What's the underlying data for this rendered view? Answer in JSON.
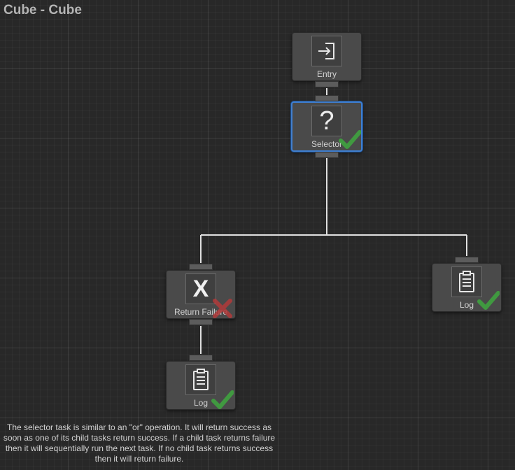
{
  "window": {
    "title": "Cube - Cube"
  },
  "nodes": {
    "entry": {
      "label": "Entry",
      "icon": "entry-arrow-icon"
    },
    "selector": {
      "label": "Selector",
      "icon": "question-mark-icon",
      "glyph": "?",
      "status": "success"
    },
    "return_failure": {
      "label": "Return Failure",
      "icon": "x-icon",
      "glyph": "X",
      "status": "failure"
    },
    "log_left": {
      "label": "Log",
      "icon": "clipboard-icon",
      "status": "success"
    },
    "log_right": {
      "label": "Log",
      "icon": "clipboard-icon",
      "status": "success"
    }
  },
  "description": "The selector task is similar to an \"or\" operation. It will return success as soon as one of its child tasks return success. If a child task returns failure then it will sequentially run the next task. If no child task returns success then it will return failure.",
  "colors": {
    "background": "#282828",
    "node": "#4a4a4a",
    "selected_border": "#3f7fd0",
    "success": "#3fa23f",
    "failure": "#b23a3a",
    "wire": "#e0e0e0"
  }
}
